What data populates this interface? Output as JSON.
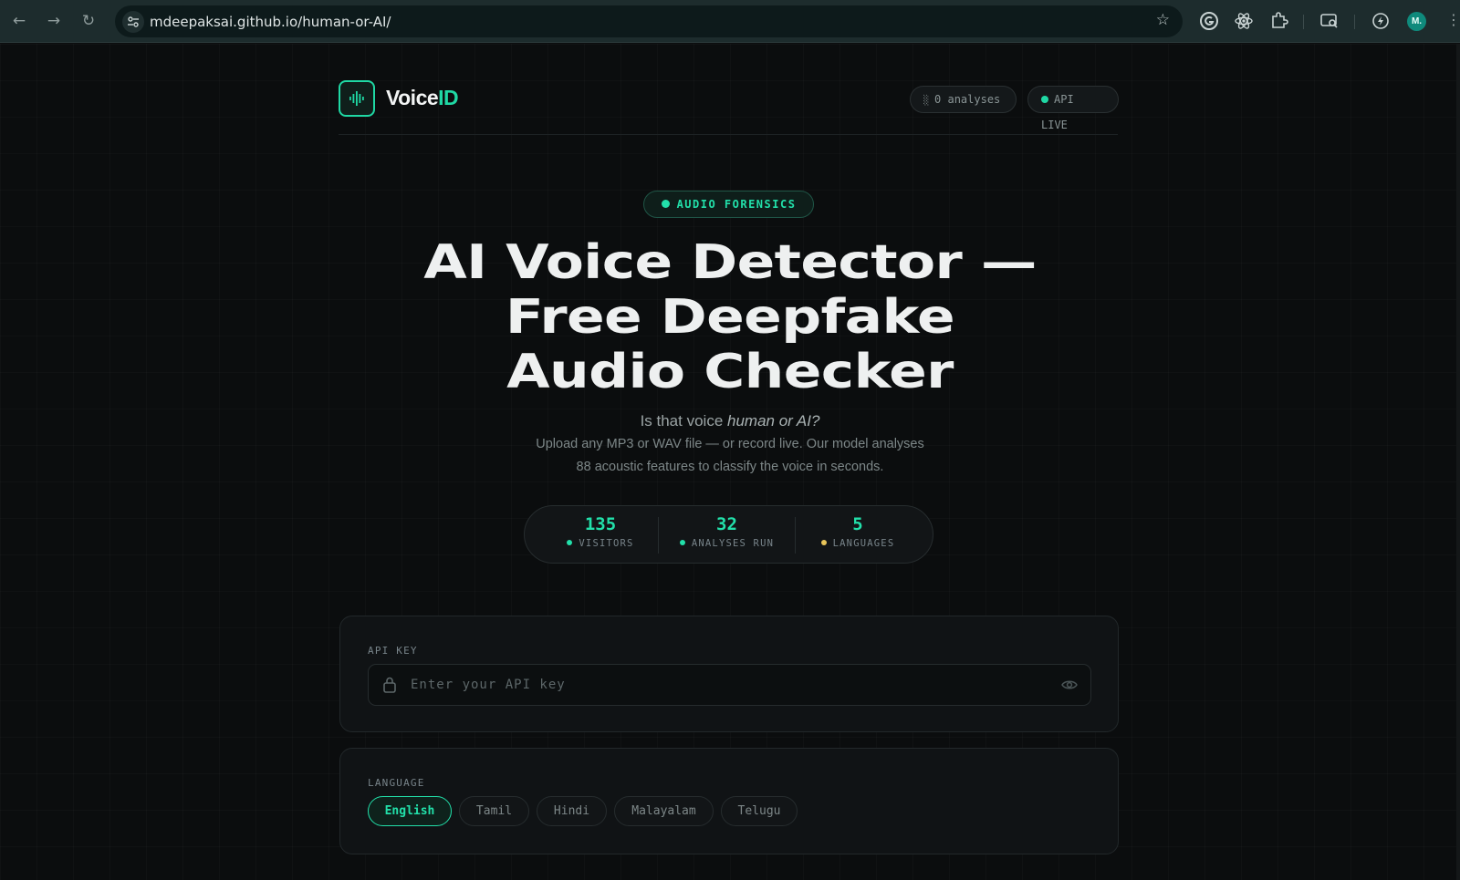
{
  "browser": {
    "url": "mdeepaksai.github.io/human-or-AI/",
    "avatar_initial": "M."
  },
  "header": {
    "brand_primary": "Voice",
    "brand_accent": "ID",
    "analyses_pill": "0 analyses",
    "api_pill": "API LIVE"
  },
  "hero": {
    "badge": "AUDIO FORENSICS",
    "title_lines": [
      "AI Voice Detector —",
      "Free Deepfake",
      "Audio Checker"
    ],
    "tagline_prefix": "Is that voice ",
    "tagline_emphasis": "human or AI?",
    "description_line1": "Upload any MP3 or WAV file — or record live. Our model analyses",
    "description_line2": "88 acoustic features to classify the voice in seconds."
  },
  "stats": [
    {
      "value": "135",
      "label": "VISITORS",
      "dot_color": "#22e0aa"
    },
    {
      "value": "32",
      "label": "ANALYSES RUN",
      "dot_color": "#22e0aa"
    },
    {
      "value": "5",
      "label": "LANGUAGES",
      "dot_color": "#e8c55a"
    }
  ],
  "api_card": {
    "label": "API KEY",
    "placeholder": "Enter your API key",
    "value": ""
  },
  "language_card": {
    "label": "LANGUAGE",
    "selected": "English",
    "options": [
      "English",
      "Tamil",
      "Hindi",
      "Malayalam",
      "Telugu"
    ]
  },
  "colors": {
    "accent": "#22e0aa",
    "background": "#0b0d0e",
    "card": "#101315"
  }
}
